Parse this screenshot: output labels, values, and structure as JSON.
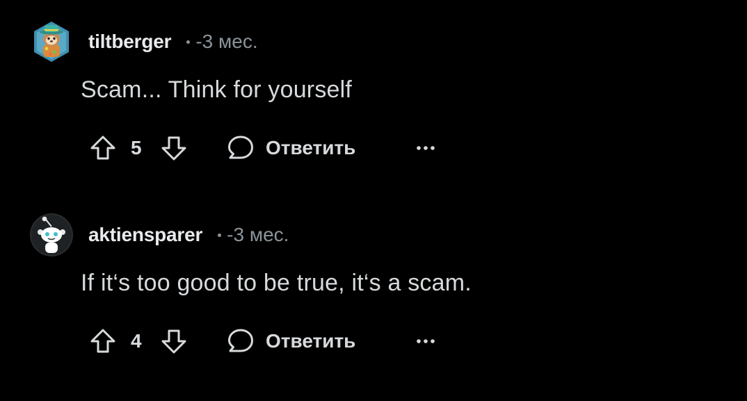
{
  "comments": [
    {
      "username": "tiltberger",
      "time": "-3 мес.",
      "text": "Scam... Think for yourself",
      "votes": "5",
      "reply_label": "Ответить",
      "avatar_icon": "snoo-avatar-hat-icon"
    },
    {
      "username": "aktiensparer",
      "time": "-3 мес.",
      "text": "If it‘s too good to be true, it‘s a scam.",
      "votes": "4",
      "reply_label": "Ответить",
      "avatar_icon": "snoo-default-avatar-icon"
    }
  ],
  "colors": {
    "background": "#000000",
    "text": "#d7dadc",
    "muted": "#8b949a",
    "avatar_teal": "#3a8fa8"
  }
}
